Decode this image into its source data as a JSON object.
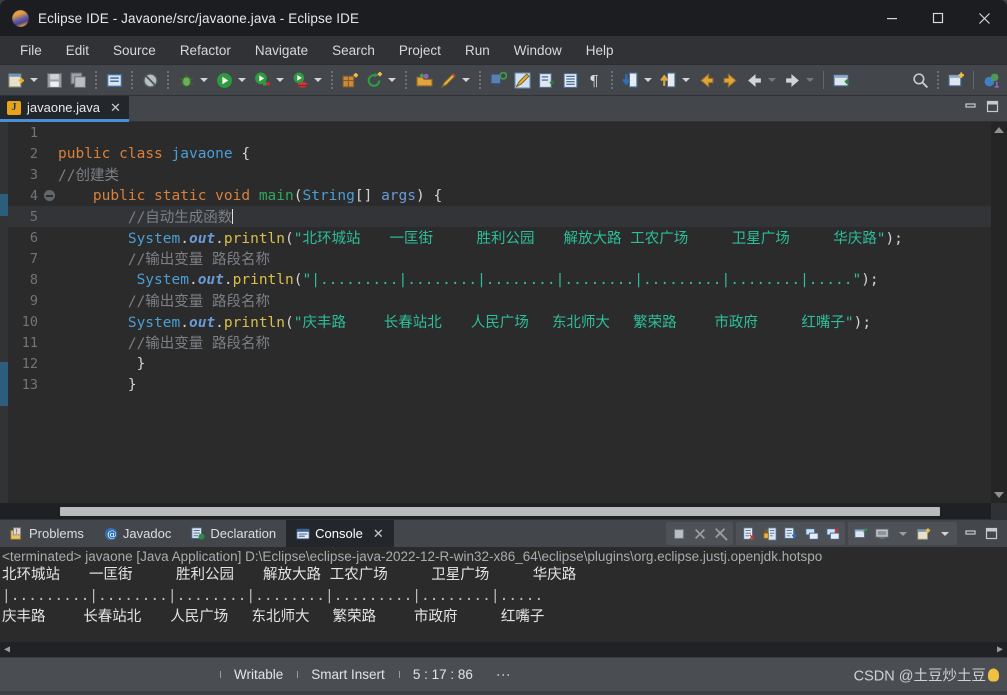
{
  "window": {
    "title": "Eclipse IDE - Javaone/src/javaone.java - Eclipse IDE",
    "logo_icon": "eclipse-logo-icon",
    "minimize_label": "Minimize",
    "maximize_label": "Maximize",
    "close_label": "Close"
  },
  "menubar": {
    "items": [
      {
        "label": "File"
      },
      {
        "label": "Edit"
      },
      {
        "label": "Source"
      },
      {
        "label": "Refactor"
      },
      {
        "label": "Navigate"
      },
      {
        "label": "Search"
      },
      {
        "label": "Project"
      },
      {
        "label": "Run"
      },
      {
        "label": "Window"
      },
      {
        "label": "Help"
      }
    ]
  },
  "toolbar": {
    "icons": [
      "new-file-icon",
      "save-icon",
      "save-all-icon",
      "print-icon",
      "no-quick-access-icon",
      "debug-icon",
      "run-icon",
      "run-configurations-icon",
      "coverage-icon",
      "new-java-package-icon",
      "refresh-icon",
      "open-type-icon",
      "annotate-icon",
      "external-tools-icon",
      "skip-breakpoints-icon",
      "toggle-mark-occurrences-icon",
      "link-editor-icon",
      "show-whitespace-icon",
      "pilcrow-icon",
      "next-annotation-icon",
      "previous-annotation-icon",
      "back-icon",
      "forward-icon",
      "previous-edit-icon",
      "next-edit-icon",
      "open-perspective-icon",
      "search-icon",
      "new-window-icon",
      "java-perspective-icon"
    ]
  },
  "editor": {
    "tab": {
      "label": "javaone.java",
      "file_icon": "java-file-icon",
      "close_icon": "close-icon"
    },
    "view_minimize_icon": "minimize-view-icon",
    "view_maximize_icon": "maximize-view-icon",
    "lines": [
      {
        "num": "1",
        "fold": false,
        "current": false,
        "tokens": []
      },
      {
        "num": "2",
        "fold": false,
        "current": false,
        "tokens": [
          {
            "t": "public",
            "c": "kw"
          },
          {
            "t": " ",
            "c": "pun"
          },
          {
            "t": "class",
            "c": "kw"
          },
          {
            "t": " ",
            "c": "pun"
          },
          {
            "t": "javaone",
            "c": "cls"
          },
          {
            "t": " ",
            "c": "pun"
          },
          {
            "t": "{",
            "c": "pun"
          }
        ]
      },
      {
        "num": "3",
        "fold": false,
        "current": false,
        "tokens": [
          {
            "t": "//创建类",
            "c": "cmt"
          }
        ]
      },
      {
        "num": "4",
        "fold": true,
        "current": false,
        "tokens": [
          {
            "t": "    ",
            "c": "pun"
          },
          {
            "t": "public",
            "c": "kw"
          },
          {
            "t": " ",
            "c": "pun"
          },
          {
            "t": "static",
            "c": "kw"
          },
          {
            "t": " ",
            "c": "pun"
          },
          {
            "t": "void",
            "c": "kw"
          },
          {
            "t": " ",
            "c": "pun"
          },
          {
            "t": "main",
            "c": "mth"
          },
          {
            "t": "(",
            "c": "pun"
          },
          {
            "t": "String",
            "c": "cls"
          },
          {
            "t": "[] ",
            "c": "pun"
          },
          {
            "t": "args",
            "c": "var"
          },
          {
            "t": ") ",
            "c": "pun"
          },
          {
            "t": "{",
            "c": "pun"
          }
        ]
      },
      {
        "num": "5",
        "fold": false,
        "current": true,
        "tokens": [
          {
            "t": "        //自动生成函数",
            "c": "cmt"
          }
        ],
        "caret": true
      },
      {
        "num": "6",
        "fold": false,
        "current": false,
        "tokens": [
          {
            "t": "        ",
            "c": "pun"
          },
          {
            "t": "System",
            "c": "cls"
          },
          {
            "t": ".",
            "c": "pun"
          },
          {
            "t": "out",
            "c": "itl"
          },
          {
            "t": ".",
            "c": "pun"
          },
          {
            "t": "println",
            "c": "fld"
          },
          {
            "t": "(",
            "c": "pun"
          },
          {
            "t": "\"北环城站　　一匡街　　　胜利公园　　解放大路 工农广场　　　卫星广场　　　华庆路\"",
            "c": "str"
          },
          {
            "t": ");",
            "c": "pun"
          }
        ]
      },
      {
        "num": "7",
        "fold": false,
        "current": false,
        "tokens": [
          {
            "t": "        //输出变量 路段名称",
            "c": "cmt"
          }
        ]
      },
      {
        "num": "8",
        "fold": false,
        "current": false,
        "tokens": [
          {
            "t": "         ",
            "c": "pun"
          },
          {
            "t": "System",
            "c": "cls"
          },
          {
            "t": ".",
            "c": "pun"
          },
          {
            "t": "out",
            "c": "itl"
          },
          {
            "t": ".",
            "c": "pun"
          },
          {
            "t": "println",
            "c": "fld"
          },
          {
            "t": "(",
            "c": "pun"
          },
          {
            "t": "\"|.........|........|........|........|.........|........|.....\"",
            "c": "str"
          },
          {
            "t": ");",
            "c": "pun"
          }
        ]
      },
      {
        "num": "9",
        "fold": false,
        "current": false,
        "tokens": [
          {
            "t": "        //输出变量 路段名称",
            "c": "cmt"
          }
        ]
      },
      {
        "num": "10",
        "fold": false,
        "current": false,
        "tokens": [
          {
            "t": "        ",
            "c": "pun"
          },
          {
            "t": "System",
            "c": "cls"
          },
          {
            "t": ".",
            "c": "pun"
          },
          {
            "t": "out",
            "c": "itl"
          },
          {
            "t": ".",
            "c": "pun"
          },
          {
            "t": "println",
            "c": "fld"
          },
          {
            "t": "(",
            "c": "pun"
          },
          {
            "t": "\"庆丰路　　 长春站北　　人民广场　 东北师大　 繁荣路　　 市政府　　　红嘴子\"",
            "c": "str"
          },
          {
            "t": ");",
            "c": "pun"
          }
        ]
      },
      {
        "num": "11",
        "fold": false,
        "current": false,
        "tokens": [
          {
            "t": "        //输出变量 路段名称",
            "c": "cmt"
          }
        ]
      },
      {
        "num": "12",
        "fold": false,
        "current": false,
        "tokens": [
          {
            "t": "         }",
            "c": "pun"
          }
        ]
      },
      {
        "num": "13",
        "fold": false,
        "current": false,
        "tokens": [
          {
            "t": "        }",
            "c": "pun"
          }
        ]
      }
    ]
  },
  "bottom_panel": {
    "tabs": [
      {
        "label": "Problems",
        "icon": "problems-icon",
        "active": false
      },
      {
        "label": "Javadoc",
        "icon": "javadoc-icon",
        "active": false
      },
      {
        "label": "Declaration",
        "icon": "declaration-icon",
        "active": false
      },
      {
        "label": "Console",
        "icon": "console-icon",
        "active": true,
        "closable": true
      }
    ],
    "tools": [
      "terminate-icon",
      "remove-launch-icon",
      "remove-all-terminated-icon",
      "clear-console-icon",
      "lock-scroll-icon",
      "scroll-lock-icon",
      "show-console-on-output-icon",
      "show-console-on-error-icon",
      "pin-console-icon",
      "display-selected-console-icon",
      "open-console-icon"
    ],
    "view_minimize_icon": "minimize-view-icon",
    "view_maximize_icon": "maximize-view-icon"
  },
  "console": {
    "header": "<terminated> javaone [Java Application] D:\\Eclipse\\eclipse-java-2022-12-R-win32-x86_64\\eclipse\\plugins\\org.eclipse.justj.openjdk.hotspo",
    "output_lines": [
      "北环城站　　一匡街　　　胜利公园　　解放大路 工农广场　　　卫星广场　　　华庆路",
      "|.........|........|........|........|.........|........|.....",
      "庆丰路　　 长春站北　　人民广场　 东北师大　 繁荣路　　 市政府　　　红嘴子"
    ],
    "scroll_left_icon": "scroll-left-icon",
    "scroll_right_icon": "scroll-right-icon"
  },
  "statusbar": {
    "writable": "Writable",
    "insert_mode": "Smart Insert",
    "position": "5 : 17 : 86",
    "overflow_icon": "more-options-icon",
    "watermark": "CSDN @土豆炒土豆"
  },
  "colors": {
    "accent_blue": "#4a90d9",
    "keyword_orange": "#d9803c",
    "class_blue": "#4b9fd5",
    "string_green": "#2cbf9a",
    "comment_gray": "#7c8085",
    "method_green": "#2fa85b",
    "editor_bg": "#2b2b2b",
    "chrome_bg": "#43474c",
    "titlebar_bg": "#1c1d21"
  }
}
